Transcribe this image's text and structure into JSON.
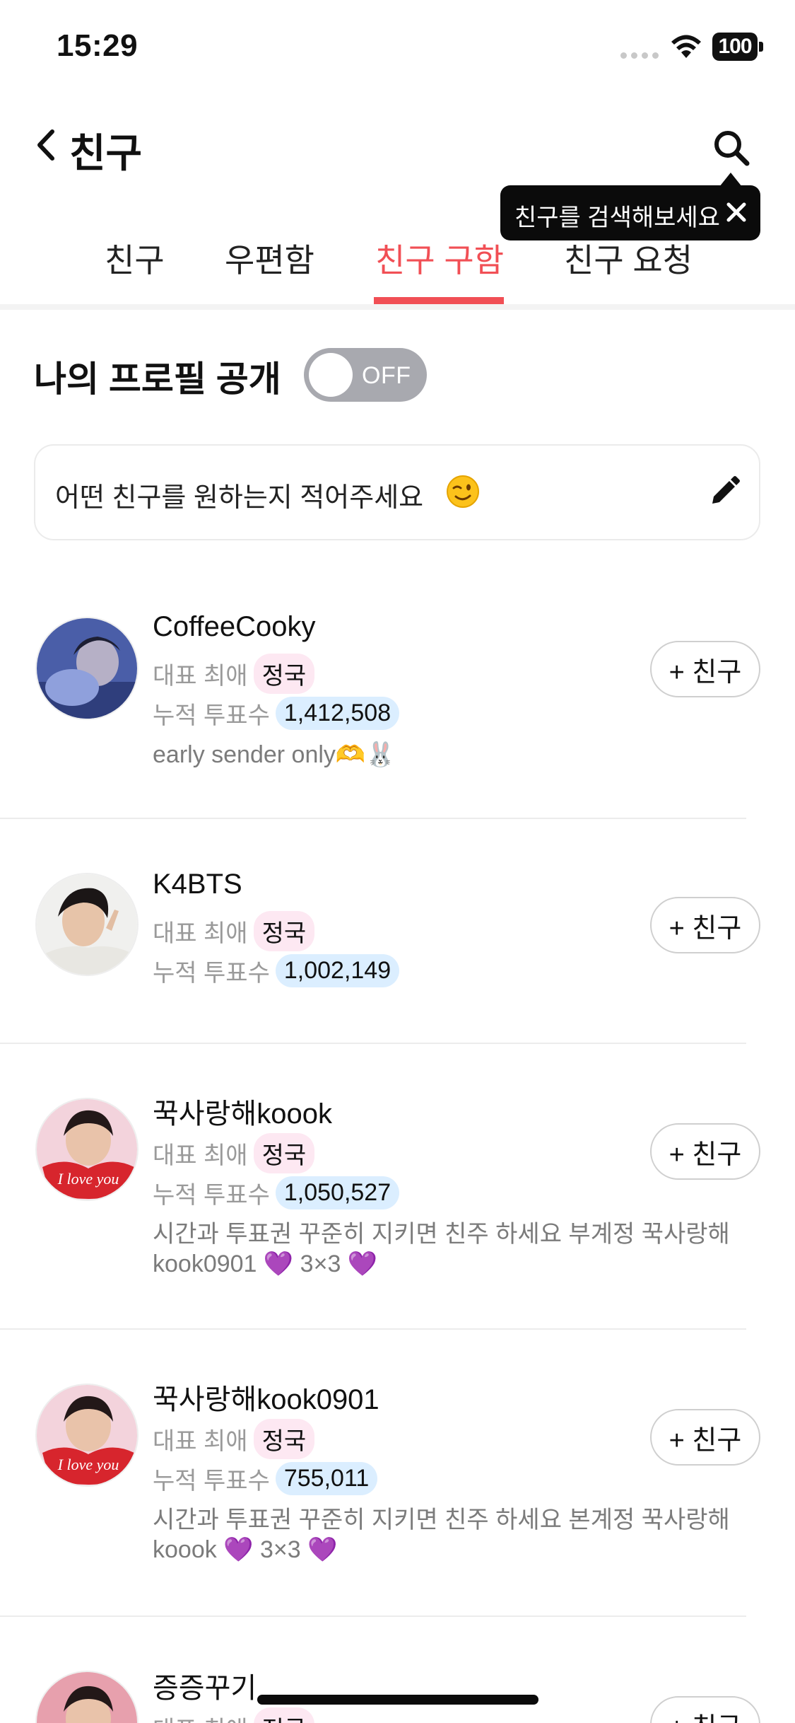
{
  "status_bar": {
    "time": "15:29",
    "battery": "100"
  },
  "header": {
    "title": "친구"
  },
  "tooltip": {
    "text": "친구를 검색해보세요"
  },
  "tabs": [
    {
      "label": "친구",
      "active": false
    },
    {
      "label": "우편함",
      "active": false
    },
    {
      "label": "친구 구함",
      "active": true
    },
    {
      "label": "친구 요청",
      "active": false
    }
  ],
  "profile_toggle": {
    "label": "나의 프로필 공개",
    "state": "OFF"
  },
  "wish_input": {
    "placeholder": "어떤 친구를 원하는지 적어주세요"
  },
  "labels": {
    "bias": "대표 최애",
    "votes": "누적 투표수",
    "add_friend": "+ 친구"
  },
  "friends": [
    {
      "nickname": "CoffeeCooky",
      "bias": "정국",
      "votes": "1,412,508",
      "bio": "early sender only🫶🐰"
    },
    {
      "nickname": "K4BTS",
      "bias": "정국",
      "votes": "1,002,149",
      "bio": ""
    },
    {
      "nickname": "꾹사랑해koook",
      "bias": "정국",
      "votes": "1,050,527",
      "bio": "시간과 투표권 꾸준히 지키면 친주 하세요 부계정 꾹사랑해 kook0901 💜 3×3 💜"
    },
    {
      "nickname": "꾹사랑해kook0901",
      "bias": "정국",
      "votes": "755,011",
      "bio": "시간과 투표권 꾸준히 지키면 친주 하세요 본계정 꾹사랑해 koook 💜 3×3 💜"
    },
    {
      "nickname": "증증꾸기",
      "bias": "정국"
    }
  ],
  "colors": {
    "accent": "#f14f55",
    "toggle_off": "#a8a9af",
    "bias_pill": "#fde8f2",
    "votes_pill": "#dbeeff"
  }
}
